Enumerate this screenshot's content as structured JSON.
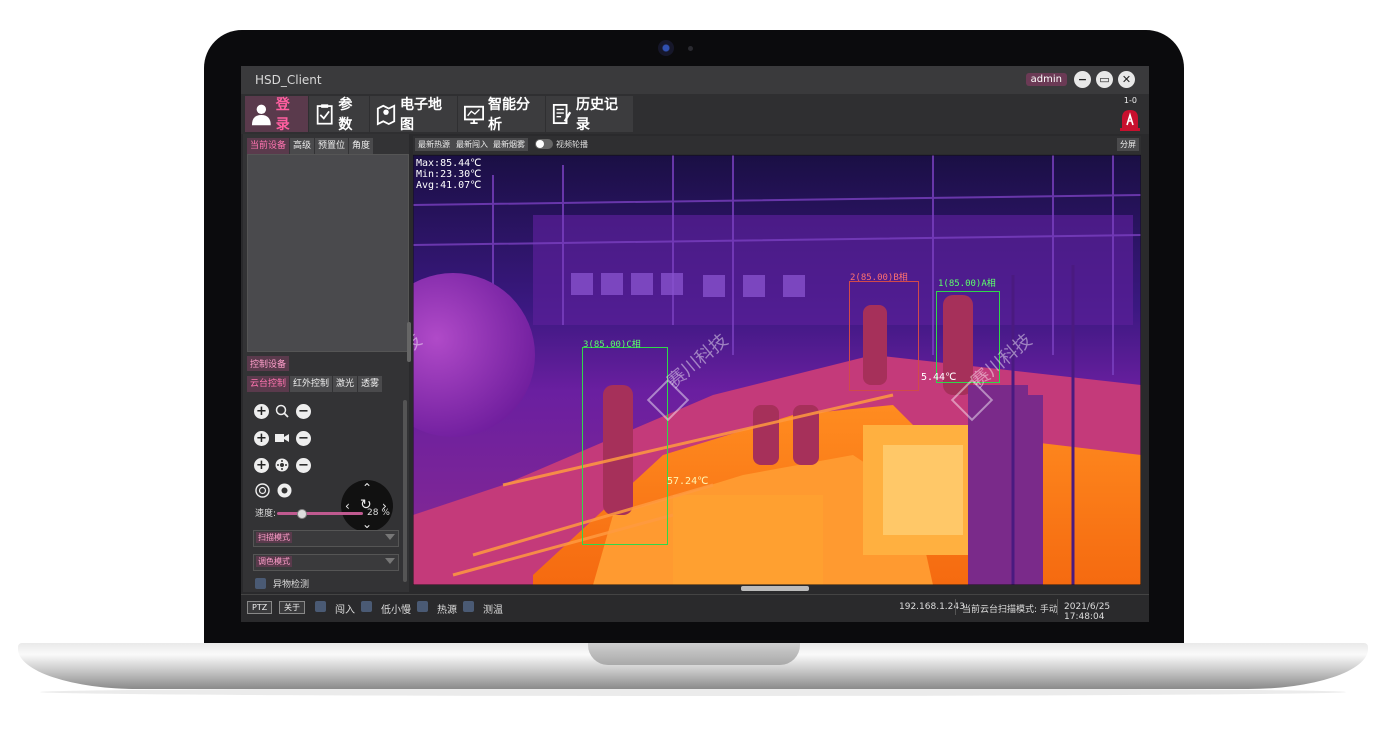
{
  "window": {
    "title": "HSD_Client",
    "user": "admin",
    "minimize_label": "−",
    "restore_label": "▭",
    "close_label": "✕"
  },
  "toolbar": {
    "items": [
      {
        "label": "登录",
        "icon": "user-icon"
      },
      {
        "label": "参数",
        "icon": "clipboard-check-icon"
      },
      {
        "label": "电子地图",
        "icon": "map-icon"
      },
      {
        "label": "智能分析",
        "icon": "monitor-icon"
      },
      {
        "label": "历史记录",
        "icon": "document-edit-icon"
      }
    ],
    "alarm_counter": "1-0",
    "alarm_icon": "alarm-bell-icon"
  },
  "left_panel": {
    "tabs": [
      "当前设备",
      "高级",
      "预置位",
      "角度"
    ],
    "control_label": "控制设备",
    "ctrl_tabs": [
      "云台控制",
      "红外控制",
      "激光",
      "透雾"
    ],
    "speed_label": "速度:",
    "speed_percent": 28,
    "speed_value": "28 %",
    "scan_mode_label": "扫描模式",
    "color_mode_label": "调色模式",
    "foreign_detect_label": "异物检测"
  },
  "video_toolbar": {
    "buttons": [
      "最新热源",
      "最新闯入",
      "最新烟雾"
    ],
    "video_loop_label": "视频轮播",
    "split_label": "分屏"
  },
  "video": {
    "stats": [
      "Max:85.44℃",
      "Min:23.30℃",
      "Avg:41.07℃"
    ],
    "detections": [
      {
        "label": "3(85.00)C相"
      },
      {
        "label": "2(85.00)B相"
      },
      {
        "label": "1(85.00)A相"
      }
    ],
    "spot_labels": [
      "57.24℃",
      "5.44℃"
    ],
    "watermark": "赛川科技"
  },
  "status_bar": {
    "ptz_label": "PTZ",
    "close_label": "关于",
    "checks": [
      "闯入",
      "低小慢",
      "热源",
      "测温"
    ],
    "ip": "192.168.1.243",
    "scan_mode": "当前云台扫描模式: 手动",
    "datetime": "2021/6/25 17:48:04"
  }
}
